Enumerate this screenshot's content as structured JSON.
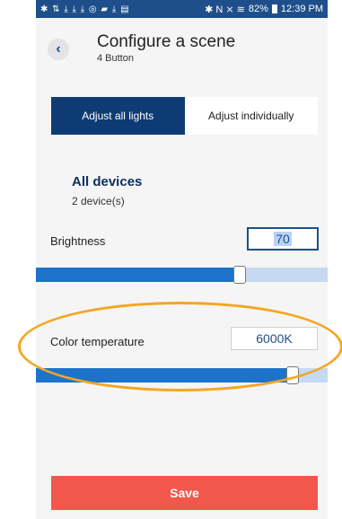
{
  "status_bar": {
    "left_icons": "✱ ⇅ ⤓ ⤓ ⤓ ◎ ▰ ⤓ ▤",
    "right_icons": "✱ N ⨯ ≋",
    "battery": "82%",
    "time": "12:39 PM"
  },
  "header": {
    "back_glyph": "‹",
    "title": "Configure a scene",
    "subtitle": "4 Button"
  },
  "mode_tabs": [
    {
      "label": "Adjust all lights",
      "active": true
    },
    {
      "label": "Adjust individually",
      "active": false
    }
  ],
  "devices": {
    "title": "All devices",
    "count": "2 device(s)"
  },
  "brightness": {
    "label": "Brightness",
    "value": "70",
    "level": 0.7
  },
  "color_temperature": {
    "label": "Color temperature",
    "value": "6000K",
    "level": 0.88
  },
  "save_label": "Save",
  "colors": {
    "primary": "#0e3b73",
    "slider_fill": "#1d73c9",
    "slider_track": "#c7d9f2",
    "save": "#f2574b",
    "highlight": "#f4a623"
  }
}
